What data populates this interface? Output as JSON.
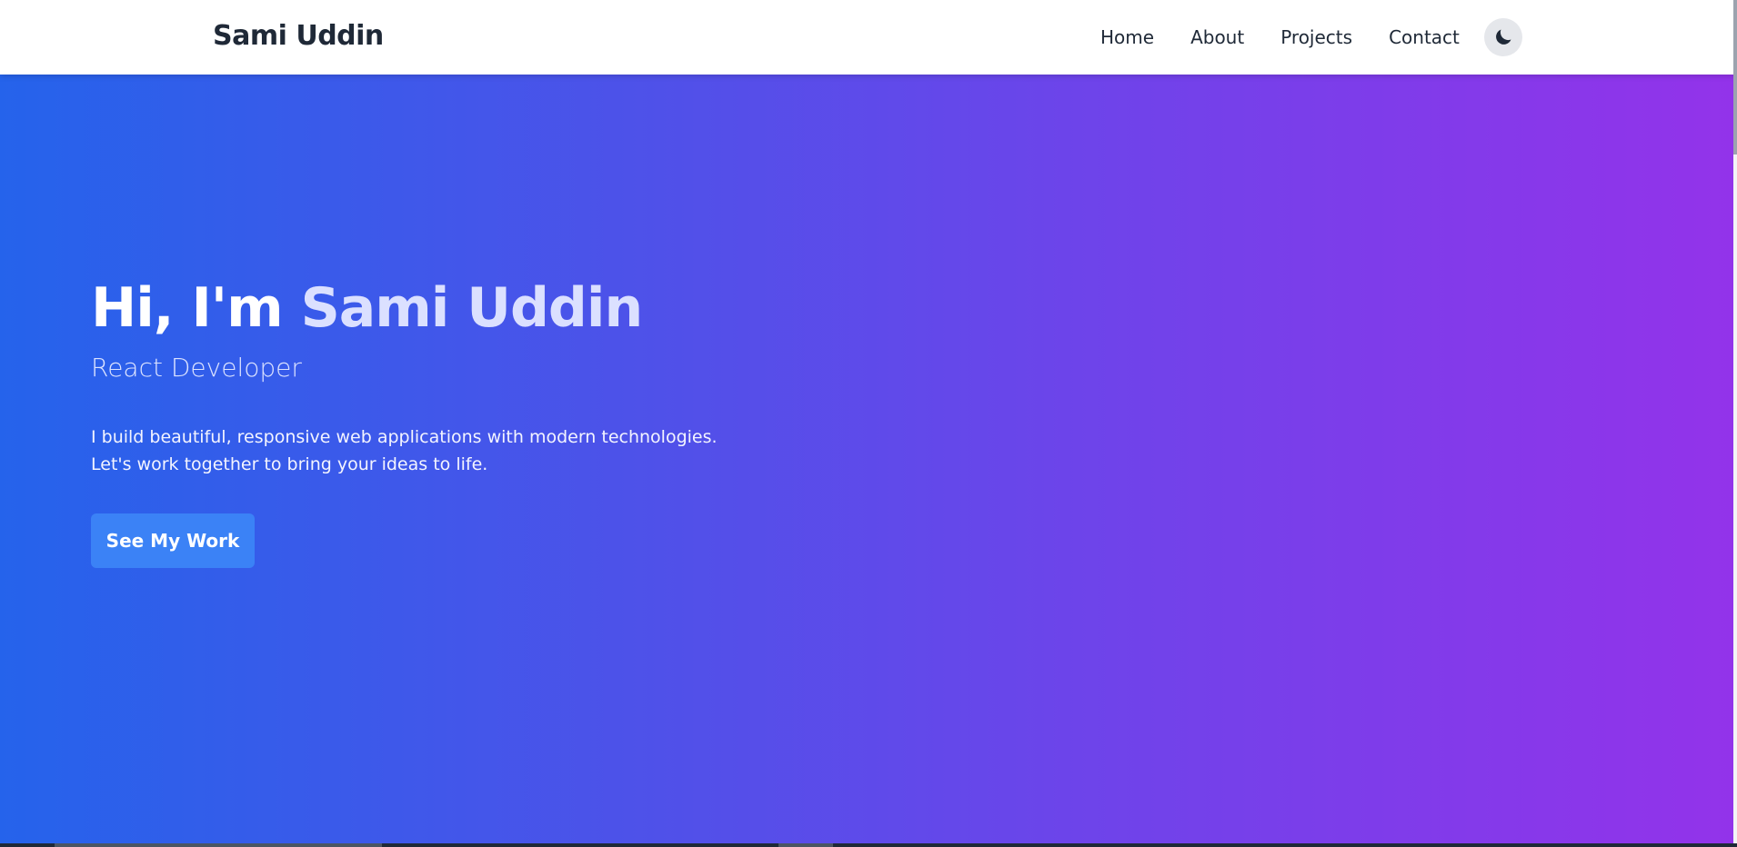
{
  "nav": {
    "brand": "Sami Uddin",
    "links": [
      "Home",
      "About",
      "Projects",
      "Contact"
    ],
    "theme_toggle_icon": "moon-icon"
  },
  "hero": {
    "greeting": "Hi, I'm ",
    "name": "Sami Uddin",
    "role": "React Developer",
    "description_line1": "I build beautiful, responsive web applications with modern technologies.",
    "description_line2": "Let's work together to bring your ideas to life.",
    "cta_label": "See My Work"
  },
  "colors": {
    "gradient_start": "#2563eb",
    "gradient_end": "#9333ea",
    "cta_bg": "#3b82f6",
    "nav_bg": "#ffffff",
    "text_dark": "#1f2937"
  }
}
